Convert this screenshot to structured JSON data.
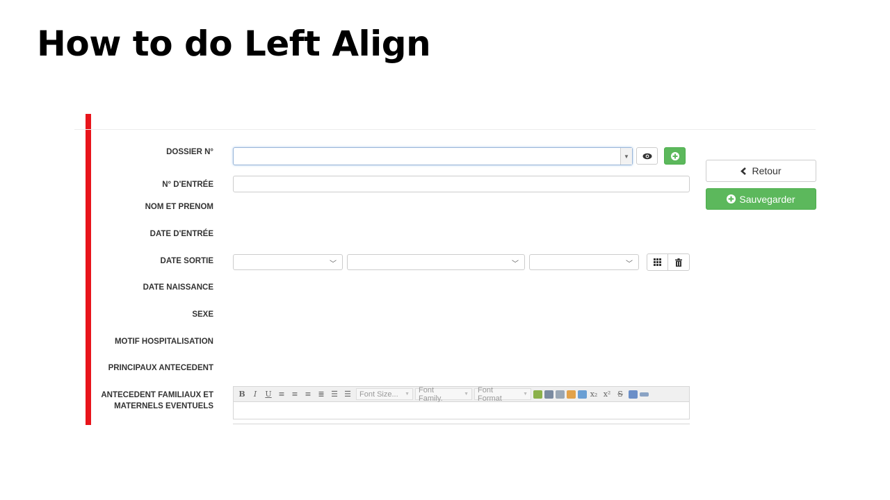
{
  "slide": {
    "title": "How to do Left Align"
  },
  "form": {
    "labels": {
      "dossier": "DOSSIER N°",
      "entree_no": "N° D'ENTRÉE",
      "nom_prenom": "NOM ET PRENOM",
      "date_entree": "DATE D'ENTRÉE",
      "date_sortie": "DATE SORTIE",
      "date_naissance": "DATE NAISSANCE",
      "sexe": "SEXE",
      "motif": "MOTIF HOSPITALISATION",
      "antecedent": "PRINCIPAUX ANTECEDENT",
      "familiaux_line1": "ANTECEDENT FAMILIAUX ET",
      "familiaux_line2": "MATERNELS EVENTUELS"
    },
    "dossier": {
      "value": "",
      "view_icon": "eye-icon",
      "add_icon": "plus-circle-icon"
    },
    "entree_no": {
      "value": ""
    },
    "date_sortie": {
      "day": "",
      "month": "",
      "year": "",
      "calendar_icon": "calendar-grid-icon",
      "clear_icon": "trash-icon"
    },
    "editor": {
      "font_size": "Font Size...",
      "font_family": "Font Family.",
      "font_format": "Font Format"
    }
  },
  "actions": {
    "back_label": "Retour",
    "back_icon": "chevron-left-icon",
    "save_label": "Sauvegarder",
    "save_icon": "plus-circle-icon"
  },
  "colors": {
    "accent_bar": "#e8141b",
    "success": "#5cb85c"
  }
}
